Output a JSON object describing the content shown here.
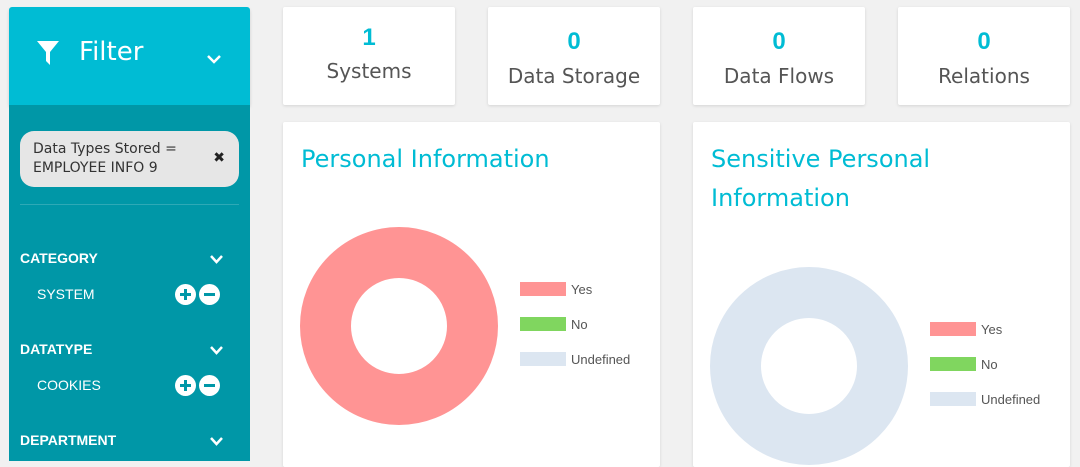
{
  "filter": {
    "title": "Filter"
  },
  "active_filter": {
    "text": "Data Types Stored = EMPLOYEE INFO 9",
    "remove": "✖"
  },
  "sections": [
    {
      "label": "CATEGORY",
      "item": "SYSTEM"
    },
    {
      "label": "DATATYPE",
      "item": "COOKIES"
    },
    {
      "label": "DEPARTMENT"
    }
  ],
  "stats": [
    {
      "value": "1",
      "label": "Systems"
    },
    {
      "value": "0",
      "label": "Data Storage"
    },
    {
      "value": "0",
      "label": "Data Flows"
    },
    {
      "value": "0",
      "label": "Relations"
    }
  ],
  "colors": {
    "accent": "#00bcd4",
    "sidebar": "#0097a7",
    "yes": "#ff9494",
    "no": "#80d65f",
    "undefined": "#dce6f1"
  },
  "chart_data": [
    {
      "type": "pie",
      "title": "Personal Information",
      "categories": [
        "Yes",
        "No",
        "Undefined"
      ],
      "values": [
        1,
        0,
        0
      ],
      "legend": "right"
    },
    {
      "type": "pie",
      "title": "Sensitive Personal Information",
      "categories": [
        "Yes",
        "No",
        "Undefined"
      ],
      "values": [
        0,
        0,
        1
      ],
      "legend": "right"
    }
  ]
}
